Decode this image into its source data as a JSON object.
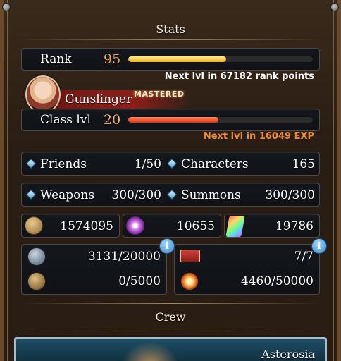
{
  "stats_header": "Stats",
  "rank": {
    "label": "Rank",
    "value": "95",
    "progress": 0.53,
    "next": "Next lvl in 67182 rank points"
  },
  "class": {
    "name": "Gunslinger",
    "badge": "MASTERED",
    "label": "Class lvl",
    "value": "20",
    "progress": 0.49,
    "next": "Next lvl in 16049 EXP"
  },
  "counts": {
    "friends_label": "Friends",
    "friends_value": "1/50",
    "characters_label": "Characters",
    "characters_value": "165",
    "weapons_label": "Weapons",
    "weapons_value": "300/300",
    "summons_label": "Summons",
    "summons_value": "300/300"
  },
  "currency": {
    "rupie": "1574095",
    "crystals": "10655",
    "stones": "19786"
  },
  "resources": {
    "stamina": "3131/20000",
    "tickets": "7/7",
    "bp": "0/5000",
    "renown": "4460/50000"
  },
  "crew_header": "Crew",
  "crew_name": "Asterosia",
  "colors": {
    "rank_bar": "#f4c22a",
    "class_bar": "#e2401f",
    "next_rank": "#ffffff",
    "next_class": "#f08a2a"
  }
}
